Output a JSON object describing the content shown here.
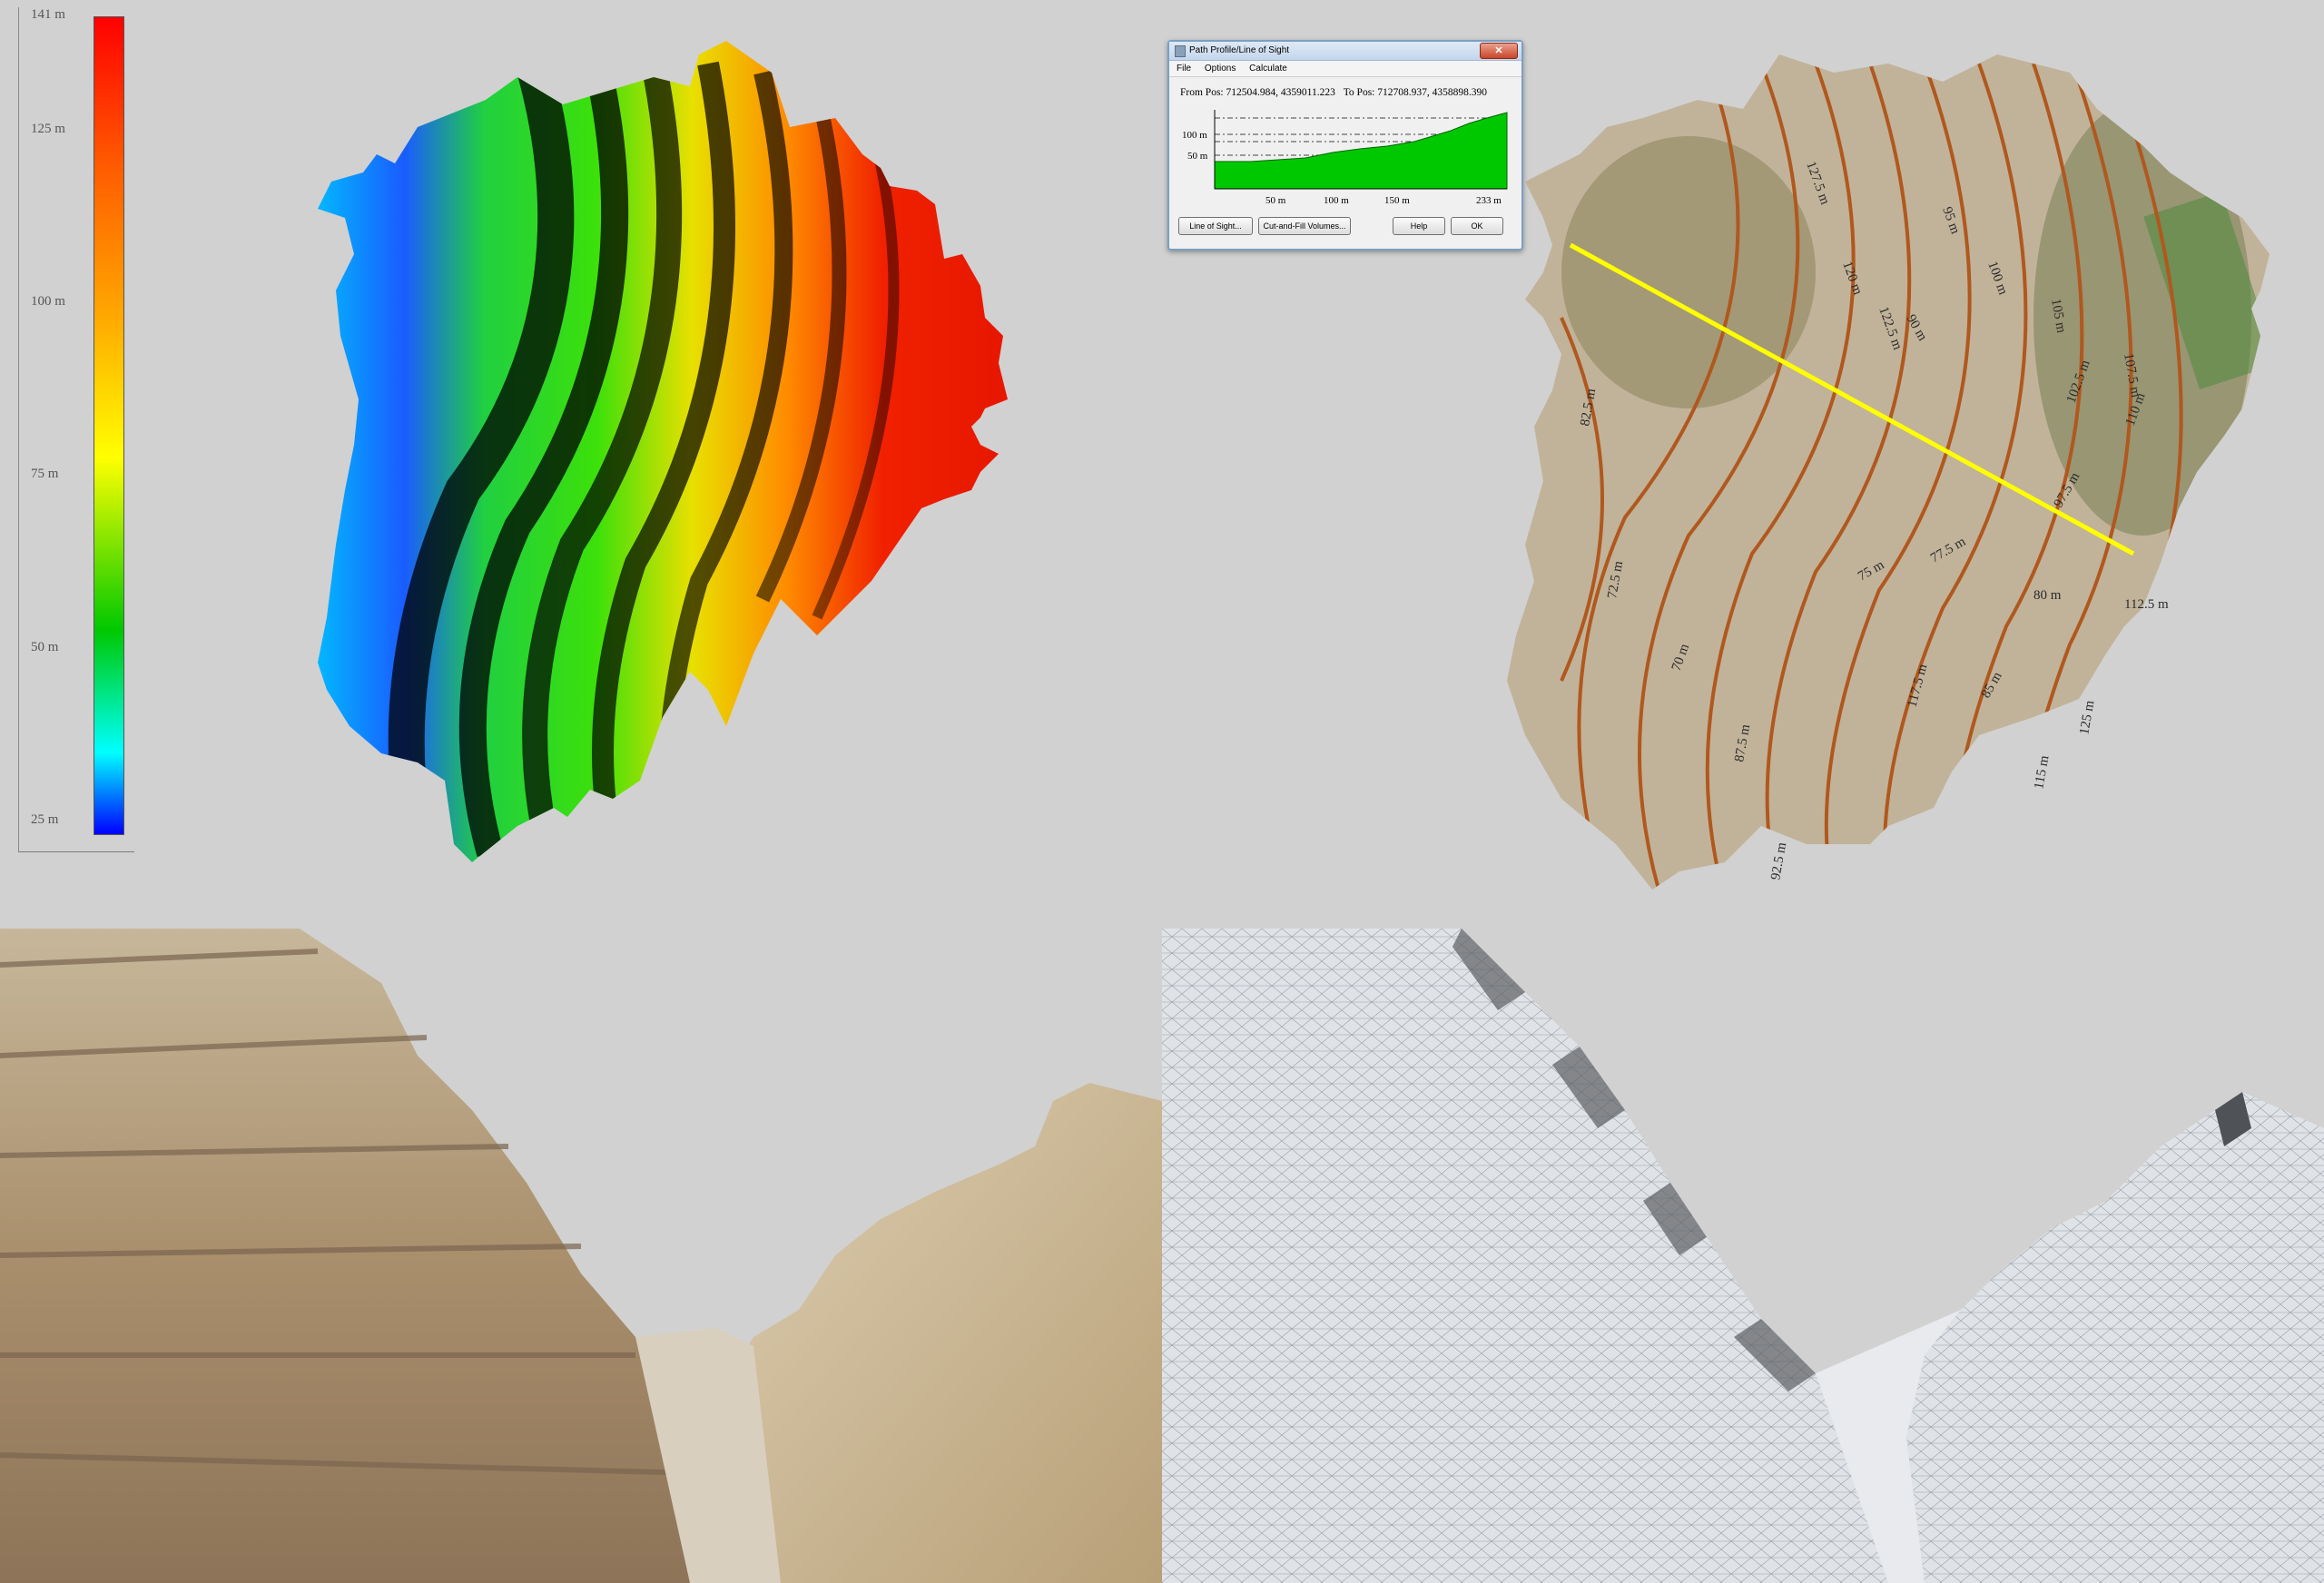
{
  "legend": {
    "ticks": [
      "141 m",
      "125 m",
      "100 m",
      "75 m",
      "50 m",
      "25 m"
    ]
  },
  "dialog": {
    "title": "Path Profile/Line of Sight",
    "close_symbol": "✕",
    "menu": [
      "File",
      "Options",
      "Calculate"
    ],
    "from_label": "From Pos:",
    "from_value": "712504.984, 4359011.223",
    "to_label": "To Pos:",
    "to_value": "712708.937, 4358898.390",
    "y_ticks": [
      "100 m",
      "50 m"
    ],
    "x_ticks": [
      "50 m",
      "100 m",
      "150 m",
      "233 m"
    ],
    "buttons": {
      "line_of_sight": "Line of Sight...",
      "cut_fill": "Cut-and-Fill Volumes...",
      "help": "Help",
      "ok": "OK"
    },
    "colors": {
      "profile_fill": "#00c800"
    }
  },
  "ortho": {
    "contour_labels": [
      "70 m",
      "72.5 m",
      "75 m",
      "77.5 m",
      "80 m",
      "82.5 m",
      "85 m",
      "87.5 m",
      "90 m",
      "92.5 m",
      "95 m",
      "97.5 m",
      "100 m",
      "102.5 m",
      "105 m",
      "107.5 m",
      "110 m",
      "112.5 m",
      "115 m",
      "117.5 m",
      "120 m",
      "122.5 m",
      "125 m",
      "127.5 m"
    ],
    "colors": {
      "contour": "#b0581e",
      "profile_line": "#ffff00"
    }
  }
}
